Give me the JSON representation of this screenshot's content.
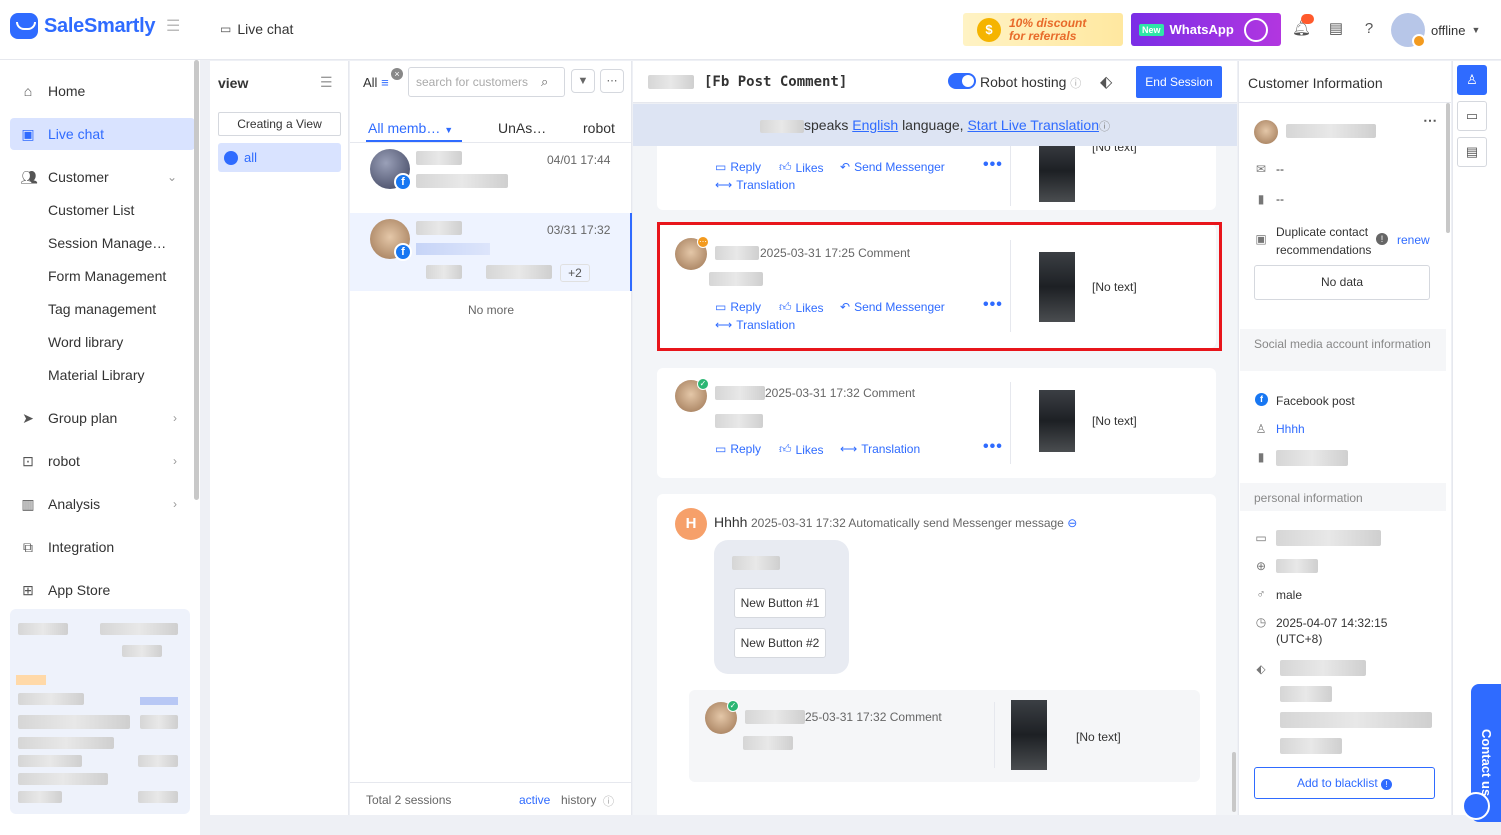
{
  "app": {
    "brand": "SaleSmartly",
    "tab_title": "Live chat",
    "promo_text_1": "10% discount",
    "promo_text_2": "for referrals",
    "whatsapp_new": "New",
    "whatsapp_label": "WhatsApp",
    "user_status": "offline"
  },
  "nav": {
    "home": "Home",
    "live_chat": "Live chat",
    "customer": "Customer",
    "customer_list": "Customer List",
    "session_manage": "Session Manage…",
    "form_management": "Form Management",
    "tag_management": "Tag management",
    "word_library": "Word library",
    "material_library": "Material Library",
    "group_plan": "Group plan",
    "robot": "robot",
    "analysis": "Analysis",
    "integration": "Integration",
    "app_store": "App Store"
  },
  "views": {
    "title": "view",
    "create": "Creating a View",
    "all": "all"
  },
  "sessions": {
    "all_label": "All",
    "search_placeholder": "search for customers",
    "tabs": [
      "All memb…",
      "UnAs…",
      "robot"
    ],
    "items": [
      {
        "time": "04/01 17:44"
      },
      {
        "time": "03/31 17:32",
        "extra": "+2"
      }
    ],
    "no_more": "No more",
    "total": "Total 2 sessions",
    "active": "active",
    "history": "history"
  },
  "conversation": {
    "title": "[Fb Post Comment]",
    "robot_hosting": "Robot hosting",
    "end_session": "End Session",
    "lang_speaks": "speaks",
    "lang_name": "English",
    "lang_word": "language,",
    "lang_start": "Start Live Translation",
    "actions": {
      "reply": "Reply",
      "likes": "Likes",
      "send_messenger": "Send Messenger",
      "translation": "Translation"
    },
    "no_text": "[No text]",
    "msg2_time": "2025-03-31 17:25",
    "msg2_type": "Comment",
    "msg3_time": "2025-03-31 17:32",
    "msg3_type": "Comment",
    "auto_name": "Hhhh",
    "auto_time": "2025-03-31 17:32",
    "auto_desc": "Automatically send Messenger message",
    "avatar_letter": "H",
    "button1": "New Button #1",
    "button2": "New Button #2",
    "quote_time": "25-03-31 17:32",
    "quote_type": "Comment"
  },
  "customer_info": {
    "title": "Customer Information",
    "email": "--",
    "phone": "--",
    "dup_label": "Duplicate contact recommendations",
    "renew": "renew",
    "no_data": "No data",
    "social_section": "Social media account information",
    "facebook_post": "Facebook post",
    "account_name": "Hhhh",
    "personal_section": "personal information",
    "gender": "male",
    "timestamp": "2025-04-07 14:32:15 (UTC+8)",
    "blacklist": "Add to blacklist",
    "contact_us": "Contact us"
  },
  "colors": {
    "accent": "#2f6bff",
    "highlight": "#e8151b",
    "active_bg": "#d9e3ff"
  }
}
